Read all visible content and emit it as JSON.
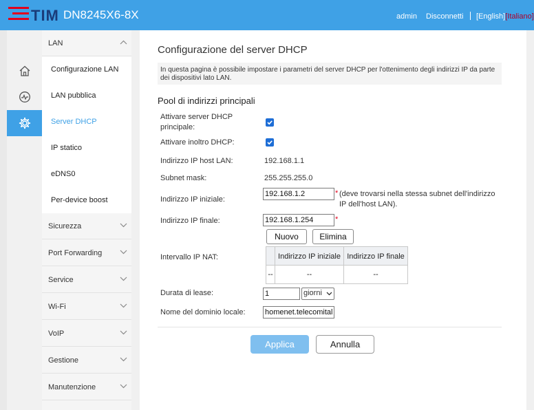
{
  "header": {
    "brand": "TIM",
    "model": "DN8245X6-8X",
    "user": "admin",
    "logout": "Disconnetti",
    "lang_en": "[English]",
    "lang_it": "[Italiano]"
  },
  "iconbar": [
    "home-icon",
    "status-icon",
    "settings-icon"
  ],
  "menu": {
    "lan": "LAN",
    "lan_items": [
      "Configurazione LAN",
      "LAN pubblica",
      "Server DHCP",
      "IP statico",
      "eDNS0",
      "Per-device boost"
    ],
    "active_item": "Server DHCP",
    "sections": [
      "Sicurezza",
      "Port Forwarding",
      "Service",
      "Wi-Fi",
      "VoIP",
      "Gestione",
      "Manutenzione"
    ]
  },
  "page": {
    "title": "Configurazione del server DHCP",
    "description": "In questa pagina è possibile impostare i parametri del server DHCP per l'ottenimento degli indirizzi IP da parte dei dispositivi lato LAN.",
    "section_title": "Pool di indirizzi principali"
  },
  "form": {
    "enable_dhcp_label_1": "Attivare server DHCP",
    "enable_dhcp_label_2": "principale:",
    "enable_dhcp": true,
    "relay_label": "Attivare inoltro DHCP:",
    "relay": true,
    "host_ip_label": "Indirizzo IP host LAN:",
    "host_ip": "192.168.1.1",
    "subnet_label": "Subnet mask:",
    "subnet": "255.255.255.0",
    "start_ip_label": "Indirizzo IP iniziale:",
    "start_ip": "192.168.1.2",
    "start_ip_note_1": "(deve trovarsi nella stessa subnet dell'indirizzo",
    "start_ip_note_2": "IP dell'host LAN).",
    "end_ip_label": "Indirizzo IP finale:",
    "end_ip": "192.168.1.254",
    "required_mark": "*",
    "new_button": "Nuovo",
    "delete_button": "Elimina",
    "nat_label": "Intervallo IP NAT:",
    "nat_headers": [
      "Indirizzo IP iniziale",
      "Indirizzo IP finale"
    ],
    "nat_row": [
      "--",
      "--",
      "--"
    ],
    "lease_label": "Durata di lease:",
    "lease_value": "1",
    "lease_unit": "giorni",
    "domain_label": "Nome del dominio locale:",
    "domain_value": "homenet.telecomitalia.it"
  },
  "actions": {
    "apply": "Applica",
    "cancel": "Annulla"
  },
  "colors": {
    "header_bg": "#3fa1e6",
    "brand_red": "#e3001b",
    "brand_navy": "#1a3c7a",
    "apply_bg": "#7fbfef"
  }
}
